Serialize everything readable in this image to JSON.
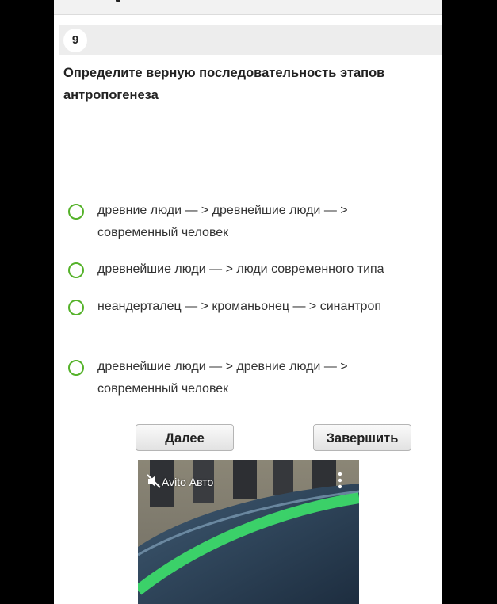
{
  "question": {
    "number": "9",
    "text": "Определите верную последовательность этапов антропогенеза"
  },
  "answers": [
    {
      "label": "древние люди — > древнейшие люди — > современный человек"
    },
    {
      "label": "древнейшие люди — > люди современного типа"
    },
    {
      "label": "неандерталец — > кроманьонец — > синантроп"
    },
    {
      "label": "древнейшие люди — > древние люди — > современный человек"
    }
  ],
  "buttons": {
    "next_label": "Далее",
    "finish_label": "Завершить"
  },
  "ad": {
    "label": "Avito Авто",
    "mute_icon": "muted-speaker-icon",
    "menu_icon": "kebab-menu-icon"
  },
  "colors": {
    "radio_border": "#55b22a",
    "question_bar": "#ededed",
    "background": "#000000"
  }
}
